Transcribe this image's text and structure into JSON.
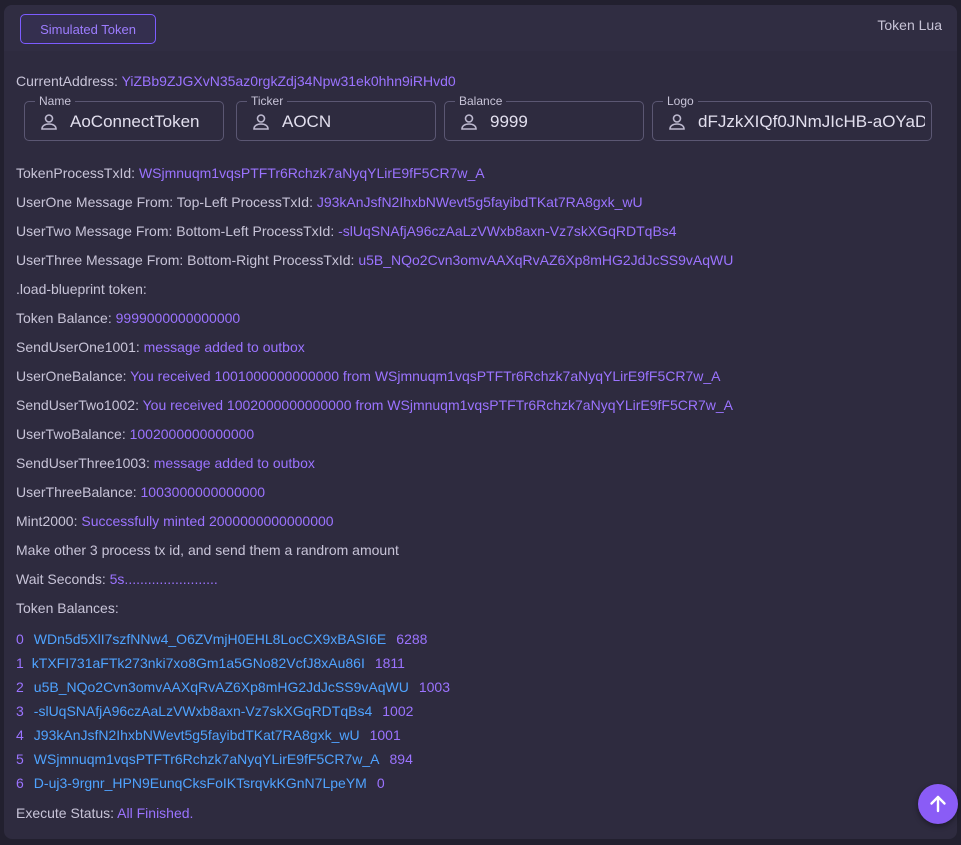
{
  "header": {
    "simulated_button": "Simulated Token",
    "right_label": "Token Lua"
  },
  "current_address": {
    "label": "CurrentAddress:",
    "value": "YiZBb9ZJGXvN35az0rgkZdj34Npw31ek0hhn9iRHvd0"
  },
  "fields": [
    {
      "legend": "Name",
      "value": "AoConnectToken",
      "icon": "user-icon"
    },
    {
      "legend": "Ticker",
      "value": "AOCN",
      "icon": "user-icon"
    },
    {
      "legend": "Balance",
      "value": "9999",
      "icon": "user-icon"
    },
    {
      "legend": "Logo",
      "value": "dFJzkXIQf0JNmJIcHB-aOYaD",
      "icon": "user-icon"
    }
  ],
  "lines": [
    {
      "label": "TokenProcessTxId: ",
      "value": "WSjmnuqm1vqsPTFTr6Rchzk7aNyqYLirE9fF5CR7w_A"
    },
    {
      "label": "UserOne Message From: Top-Left ProcessTxId: ",
      "value": "J93kAnJsfN2IhxbNWevt5g5fayibdTKat7RA8gxk_wU"
    },
    {
      "label": "UserTwo Message From: Bottom-Left ProcessTxId: ",
      "value": "-slUqSNAfjA96czAaLzVWxb8axn-Vz7skXGqRDTqBs4"
    },
    {
      "label": "UserThree Message From: Bottom-Right ProcessTxId: ",
      "value": "u5B_NQo2Cvn3omvAAXqRvAZ6Xp8mHG2JdJcSS9vAqWU"
    },
    {
      "label": ".load-blueprint token:",
      "value": ""
    },
    {
      "label": "Token Balance: ",
      "value": "9999000000000000"
    },
    {
      "label": "SendUserOne1001: ",
      "value": "message added to outbox"
    },
    {
      "label": "UserOneBalance: ",
      "value": "You received 1001000000000000 from WSjmnuqm1vqsPTFTr6Rchzk7aNyqYLirE9fF5CR7w_A"
    },
    {
      "label": "SendUserTwo1002: ",
      "value": "You received 1002000000000000 from WSjmnuqm1vqsPTFTr6Rchzk7aNyqYLirE9fF5CR7w_A"
    },
    {
      "label": "UserTwoBalance: ",
      "value": "1002000000000000"
    },
    {
      "label": "SendUserThree1003: ",
      "value": "message added to outbox"
    },
    {
      "label": "UserThreeBalance: ",
      "value": "1003000000000000"
    },
    {
      "label": "Mint2000: ",
      "value": "Successfully minted 2000000000000000"
    },
    {
      "label": "Make other 3 process tx id, and send them a randrom amount",
      "value": ""
    },
    {
      "label": "Wait Seconds: ",
      "value": "5s........................"
    },
    {
      "label": "Token Balances:",
      "value": ""
    }
  ],
  "balances": [
    {
      "index": "0",
      "id": "WDn5d5XlI7szfNNw4_O6ZVmjH0EHL8LocCX9xBASI6E",
      "amount": "6288"
    },
    {
      "index": "1",
      "id": "kTXFI731aFTk273nki7xo8Gm1a5GNo82VcfJ8xAu86I",
      "amount": "1811"
    },
    {
      "index": "2",
      "id": "u5B_NQo2Cvn3omvAAXqRvAZ6Xp8mHG2JdJcSS9vAqWU",
      "amount": "1003"
    },
    {
      "index": "3",
      "id": "-slUqSNAfjA96czAaLzVWxb8axn-Vz7skXGqRDTqBs4",
      "amount": "1002"
    },
    {
      "index": "4",
      "id": "J93kAnJsfN2IhxbNWevt5g5fayibdTKat7RA8gxk_wU",
      "amount": "1001"
    },
    {
      "index": "5",
      "id": "WSjmnuqm1vqsPTFTr6Rchzk7aNyqYLirE9fF5CR7w_A",
      "amount": "894"
    },
    {
      "index": "6",
      "id": "D-uj3-9rgnr_HPN9EunqCksFoIKTsrqvkKGnN7LpeYM",
      "amount": "0"
    }
  ],
  "execute_status": {
    "label": "Execute Status: ",
    "value": "All Finished."
  },
  "fab": {
    "icon": "arrow-up-icon"
  },
  "colors": {
    "accent": "#9b73ff",
    "link_blue": "#4fa3ff",
    "background": "#22202f",
    "card": "#2e2b3f"
  }
}
